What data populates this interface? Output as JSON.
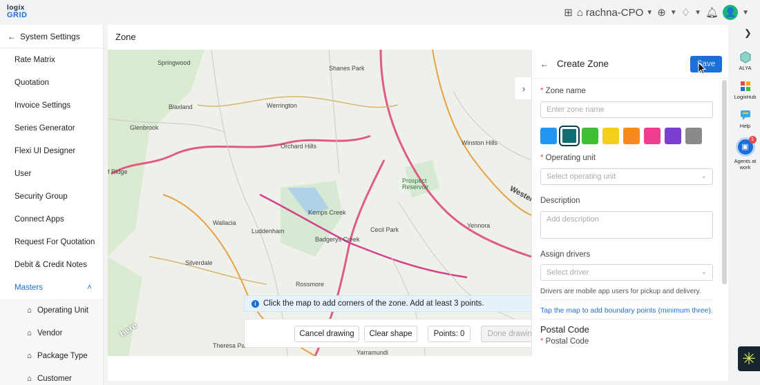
{
  "app": {
    "logo_top": "logix",
    "logo_bottom": "GRID",
    "user_name": "rachna-CPO",
    "avatar_initial": "👤"
  },
  "sidebar": {
    "back_label": "System Settings",
    "items": [
      {
        "label": "Rate Matrix"
      },
      {
        "label": "Quotation"
      },
      {
        "label": "Invoice Settings"
      },
      {
        "label": "Series Generator"
      },
      {
        "label": "Flexi UI Designer"
      },
      {
        "label": "User"
      },
      {
        "label": "Security Group"
      },
      {
        "label": "Connect Apps"
      },
      {
        "label": "Request For Quotation"
      },
      {
        "label": "Debit & Credit Notes"
      }
    ],
    "masters_label": "Masters",
    "sub_items": [
      {
        "label": "Operating Unit"
      },
      {
        "label": "Vendor"
      },
      {
        "label": "Package Type"
      },
      {
        "label": "Customer"
      }
    ]
  },
  "main": {
    "title": "Zone"
  },
  "map": {
    "info_text": "Click the map to add corners of the zone. Add at least 3 points.",
    "cancel_label": "Cancel drawing",
    "clear_label": "Clear shape",
    "points_label": "Points: 0",
    "done_label": "Done drawing",
    "provider": "here",
    "labels": [
      {
        "text": "Springwood"
      },
      {
        "text": "Shanes Park"
      },
      {
        "text": "Blaxland"
      },
      {
        "text": "Werrington"
      },
      {
        "text": "Glenbrook"
      },
      {
        "text": "Orchard Hills"
      },
      {
        "text": "Winston Hills"
      },
      {
        "text": "f Ridge"
      },
      {
        "text": "Prospect Reservoir"
      },
      {
        "text": "Wallacia"
      },
      {
        "text": "Luddenham"
      },
      {
        "text": "Kemps Creek"
      },
      {
        "text": "Cecil Park"
      },
      {
        "text": "Yennora"
      },
      {
        "text": "Badgerys Creek"
      },
      {
        "text": "Silverdale"
      },
      {
        "text": "Rossmore"
      },
      {
        "text": "Theresa Park"
      },
      {
        "text": "Yarramundi"
      },
      {
        "text": "Western"
      }
    ]
  },
  "panel": {
    "title": "Create Zone",
    "save_label": "Save",
    "zone_name_label": "Zone name",
    "zone_name_placeholder": "Enter zone name",
    "swatch_colors": [
      "#2196f3",
      "#0e6e72",
      "#3fbf32",
      "#f5cf1c",
      "#f78a1e",
      "#ec3f8f",
      "#7a3fd0",
      "#8a8a8a"
    ],
    "operating_unit_label": "Operating unit",
    "operating_unit_placeholder": "Select operating unit",
    "description_label": "Description",
    "description_placeholder": "Add description",
    "assign_drivers_label": "Assign drivers",
    "driver_placeholder": "Select driver",
    "drivers_hint": "Drivers are mobile app users for pickup and delivery.",
    "map_hint": "Tap the map to add boundary points (minimum three).",
    "postal_section": "Postal Code",
    "postal_label": "Postal Code"
  },
  "rail": {
    "items": [
      {
        "label": "ALYA"
      },
      {
        "label": "LogixHub"
      },
      {
        "label": "Help"
      },
      {
        "label": "Agents at work"
      }
    ],
    "agent_badge": "1"
  }
}
